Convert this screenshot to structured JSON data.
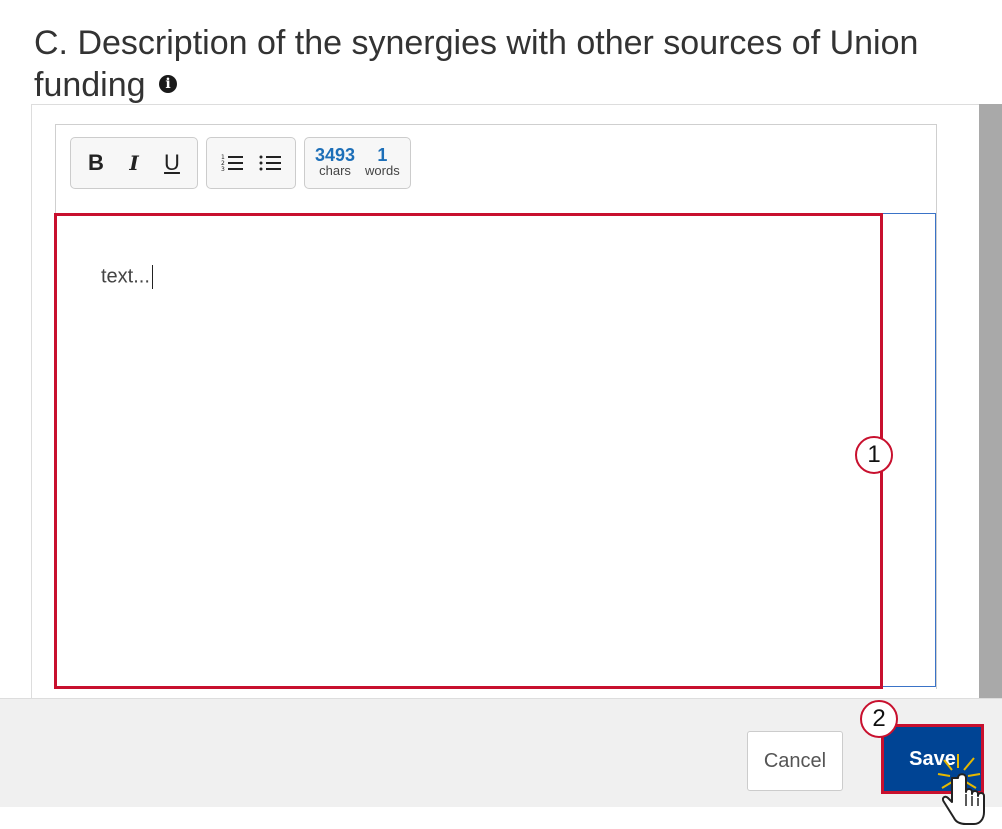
{
  "section": {
    "title": "C. Description of the synergies with other sources of Union funding",
    "info_icon": "info-circle-icon"
  },
  "toolbar": {
    "bold_label": "B",
    "italic_label": "I",
    "underline_label": "U",
    "ordered_list_icon": "ordered-list-icon",
    "unordered_list_icon": "unordered-list-icon",
    "chars_count": "3493",
    "chars_label": "chars",
    "words_count": "1",
    "words_label": "words"
  },
  "editor": {
    "value": "text..."
  },
  "callouts": {
    "one": "1",
    "two": "2"
  },
  "actions": {
    "cancel_label": "Cancel",
    "save_label": "Save"
  },
  "colors": {
    "highlight_red": "#c8102e",
    "save_blue": "#004494",
    "counter_blue": "#1d6fb8"
  }
}
